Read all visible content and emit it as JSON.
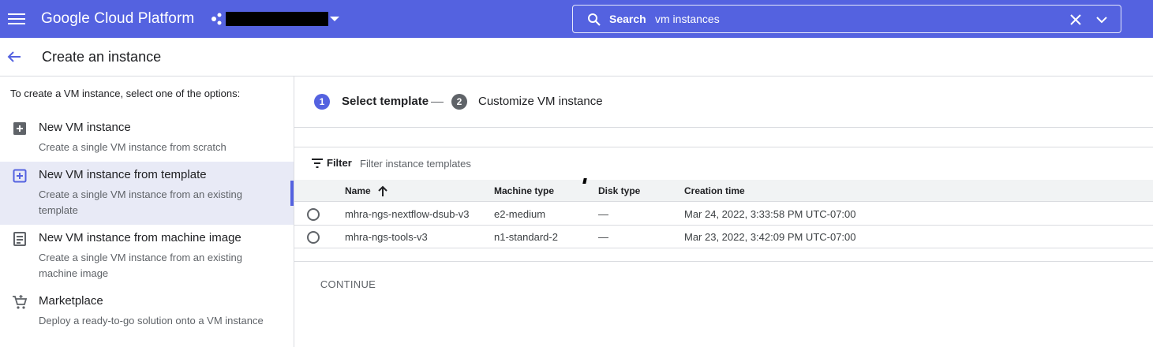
{
  "topbar": {
    "brand": "Google Cloud Platform",
    "search": {
      "label": "Search",
      "value": "vm instances",
      "icon": "search-icon"
    },
    "colors": {
      "bar": "#5462e0"
    }
  },
  "page": {
    "title": "Create an instance"
  },
  "left": {
    "intro": "To create a VM instance, select one of the options:",
    "options": [
      {
        "title": "New VM instance",
        "desc": "Create a single VM instance from scratch",
        "icon": "add-box-icon",
        "selected": false
      },
      {
        "title": "New VM instance from template",
        "desc": "Create a single VM instance from an existing template",
        "icon": "add-box-outline-icon",
        "selected": true
      },
      {
        "title": "New VM instance from machine image",
        "desc": "Create a single VM instance from an existing machine image",
        "icon": "machine-image-icon",
        "selected": false
      },
      {
        "title": "Marketplace",
        "desc": "Deploy a ready-to-go solution onto a VM instance",
        "icon": "cart-icon",
        "selected": false
      }
    ]
  },
  "stepper": {
    "steps": [
      {
        "num": "1",
        "label": "Select template",
        "active": true
      },
      {
        "num": "2",
        "label": "Customize VM instance",
        "active": false
      }
    ]
  },
  "filter": {
    "label": "Filter",
    "placeholder": "Filter instance templates"
  },
  "table": {
    "columns": [
      "Name",
      "Machine type",
      "Disk type",
      "Creation time"
    ],
    "sort": {
      "column": "Name",
      "direction": "ascending"
    },
    "rows": [
      {
        "name": "mhra-ngs-nextflow-dsub-v3",
        "machine": "e2-medium",
        "disk": "—",
        "created": "Mar 24, 2022, 3:33:58 PM UTC-07:00"
      },
      {
        "name": "mhra-ngs-tools-v3",
        "machine": "n1-standard-2",
        "disk": "—",
        "created": "Mar 23, 2022, 3:42:09 PM UTC-07:00"
      }
    ]
  },
  "actions": {
    "continue": "CONTINUE"
  }
}
